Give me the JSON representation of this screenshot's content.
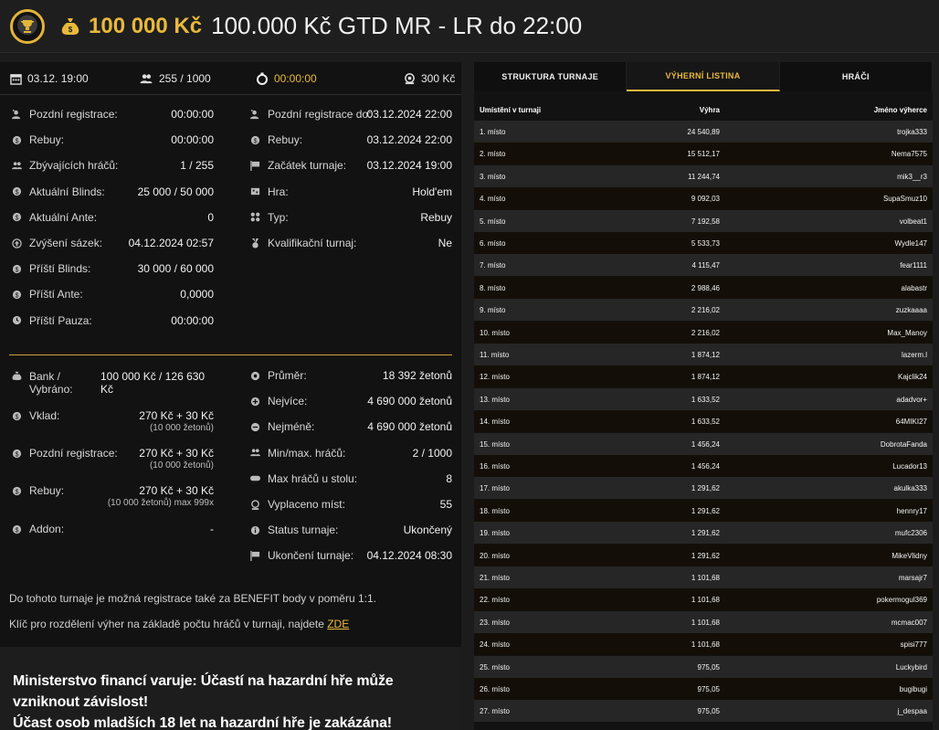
{
  "header": {
    "prize": "100 000 Kč",
    "title": "100.000 Kč GTD MR - LR do 22:00"
  },
  "topbar": {
    "date": "03.12. 19:00",
    "players": "255 / 1000",
    "timer": "00:00:00",
    "buyin": "300 Kč"
  },
  "left_rows": [
    {
      "icon": "user-add-icon",
      "label": "Pozdní registrace:",
      "value": "00:00:00"
    },
    {
      "icon": "rebuy-icon",
      "label": "Rebuy:",
      "value": "00:00:00"
    },
    {
      "icon": "players-icon",
      "label": "Zbývajících hráčů:",
      "value": "1 / 255"
    },
    {
      "icon": "blinds-icon",
      "label": "Aktuální Blinds:",
      "value": "25 000 / 50 000"
    },
    {
      "icon": "ante-icon",
      "label": "Aktuální Ante:",
      "value": "0"
    },
    {
      "icon": "level-up-icon",
      "label": "Zvýšení sázek:",
      "value": "04.12.2024 02:57"
    },
    {
      "icon": "blinds-icon",
      "label": "Příští Blinds:",
      "value": "30 000 / 60 000"
    },
    {
      "icon": "ante-icon",
      "label": "Příští Ante:",
      "value": "0,0000"
    },
    {
      "icon": "clock-icon",
      "label": "Příští Pauza:",
      "value": "00:00:00"
    }
  ],
  "right_rows": [
    {
      "icon": "user-add-icon",
      "label": "Pozdní registrace do:",
      "value": "03.12.2024 22:00"
    },
    {
      "icon": "rebuy-icon",
      "label": "Rebuy:",
      "value": "03.12.2024 22:00"
    },
    {
      "icon": "flag-icon",
      "label": "Začátek turnaje:",
      "value": "03.12.2024 19:00"
    },
    {
      "icon": "cards-icon",
      "label": "Hra:",
      "value": "Hold'em"
    },
    {
      "icon": "suits-icon",
      "label": "Typ:",
      "value": "Rebuy"
    },
    {
      "icon": "medal-icon",
      "label": "Kvalifikační turnaj:",
      "value": "Ne"
    }
  ],
  "money": {
    "bank_label": "Bank / Vybráno:",
    "bank_value": "100 000 Kč / 126 630 Kč",
    "deposit_label": "Vklad:",
    "deposit_value": "270 Kč + 30 Kč",
    "deposit_sub": "(10 000 žetonů)",
    "late_label": "Pozdní registrace:",
    "late_value": "270 Kč + 30 Kč",
    "late_sub": "(10 000 žetonů)",
    "rebuy_label": "Rebuy:",
    "rebuy_value": "270 Kč + 30 Kč",
    "rebuy_sub": "(10 000 žetonů) max 999x",
    "addon_label": "Addon:",
    "addon_value": "-"
  },
  "stats": [
    {
      "icon": "chip-icon",
      "label": "Průměr:",
      "value": "18 392 žetonů"
    },
    {
      "icon": "chip-plus-icon",
      "label": "Nejvíce:",
      "value": "4 690 000 žetonů"
    },
    {
      "icon": "chip-minus-icon",
      "label": "Nejméně:",
      "value": "4 690 000 žetonů"
    },
    {
      "icon": "players-icon",
      "label": "Min/max. hráčů:",
      "value": "2 / 1000"
    },
    {
      "icon": "table-icon",
      "label": "Max hráčů u stolu:",
      "value": "8"
    },
    {
      "icon": "payout-icon",
      "label": "Vyplaceno míst:",
      "value": "55"
    },
    {
      "icon": "info-icon",
      "label": "Status turnaje:",
      "value": "Ukončený"
    },
    {
      "icon": "flag-icon",
      "label": "Ukončení turnaje:",
      "value": "04.12.2024 08:30"
    }
  ],
  "notes": {
    "benefit": "Do tohoto turnaje je možná registrace také za BENEFIT body v poměru 1:1.",
    "key": "Klíč pro rozdělení výher na základě počtu hráčů v turnaji, najdete",
    "link": "ZDE"
  },
  "warning": {
    "line1": "Ministerstvo financí varuje: Účastí na hazardní hře může vzniknout závislost!",
    "line2": "Účast osob mladších 18 let na hazardní hře je zakázána!"
  },
  "tabs": [
    "STRUKTURA TURNAJE",
    "VÝHERNÍ LISTINA",
    "HRÁČI"
  ],
  "table": {
    "headers": [
      "Umístění v turnaji",
      "Výhra",
      "Jméno výherce"
    ],
    "rows": [
      [
        "1. místo",
        "24 540,89",
        "trojka333"
      ],
      [
        "2. místo",
        "15 512,17",
        "Nema7575"
      ],
      [
        "3. místo",
        "11 244,74",
        "mik3__r3"
      ],
      [
        "4. místo",
        "9 092,03",
        "SupaSmuz10"
      ],
      [
        "5. místo",
        "7 192,58",
        "volbeat1"
      ],
      [
        "6. místo",
        "5 533,73",
        "Wydle147"
      ],
      [
        "7. místo",
        "4 115,47",
        "fear1111"
      ],
      [
        "8. místo",
        "2 988,46",
        "alabastr"
      ],
      [
        "9. místo",
        "2 216,02",
        "zuzkaaaa"
      ],
      [
        "10. místo",
        "2 216,02",
        "Max_Manoy"
      ],
      [
        "11. místo",
        "1 874,12",
        "lazerm.l"
      ],
      [
        "12. místo",
        "1 874,12",
        "Kajclik24"
      ],
      [
        "13. místo",
        "1 633,52",
        "adadvor+"
      ],
      [
        "14. místo",
        "1 633,52",
        "64MIKI27"
      ],
      [
        "15. místo",
        "1 456,24",
        "DobrotaFanda"
      ],
      [
        "16. místo",
        "1 456,24",
        "Lucador13"
      ],
      [
        "17. místo",
        "1 291,62",
        "akulka333"
      ],
      [
        "18. místo",
        "1 291,62",
        "hennry17"
      ],
      [
        "19. místo",
        "1 291,62",
        "mufc2306"
      ],
      [
        "20. místo",
        "1 291,62",
        "MikeVlidny"
      ],
      [
        "21. místo",
        "1 101,68",
        "marsajr7"
      ],
      [
        "22. místo",
        "1 101,68",
        "pokermogul369"
      ],
      [
        "23. místo",
        "1 101,68",
        "mcmac007"
      ],
      [
        "24. místo",
        "1 101,68",
        "spisi777"
      ],
      [
        "25. místo",
        "975,05",
        "Luckybird"
      ],
      [
        "26. místo",
        "975,05",
        "bugibugi"
      ],
      [
        "27. místo",
        "975,05",
        "j_despaa"
      ]
    ]
  }
}
